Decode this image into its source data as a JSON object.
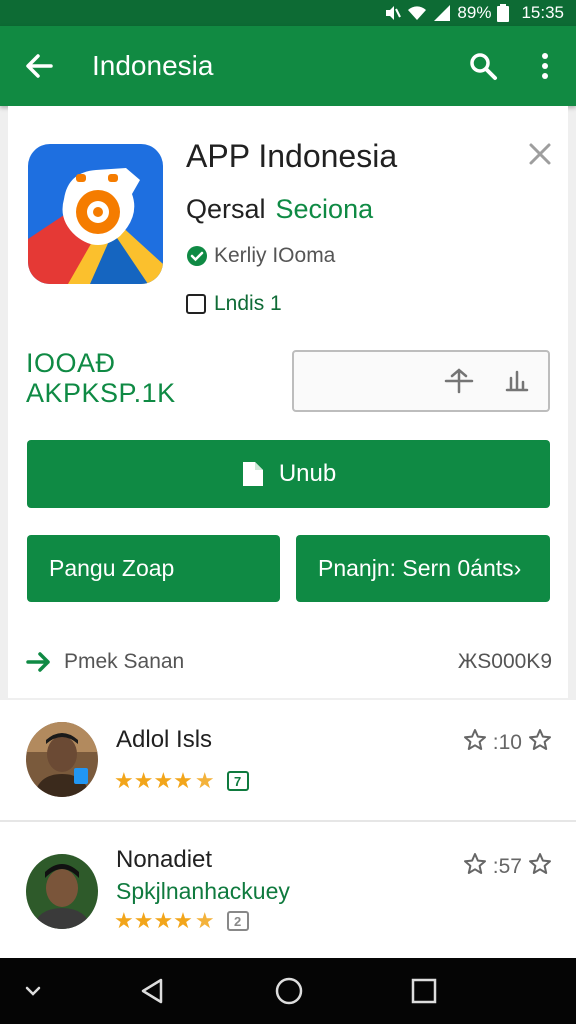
{
  "status_bar": {
    "battery": "89%",
    "time": "15:35"
  },
  "app_bar": {
    "title": "Indonesia"
  },
  "app": {
    "name": "APP Indonesia",
    "developer_part1": "Qersal",
    "developer_part2": "Seciona",
    "verified_label": "Kerliy IOoma",
    "content_rating_label": "Lndis 1",
    "meta_line1": "IOOAÐ",
    "meta_line2": "AKPKSP.1K"
  },
  "buttons": {
    "install": "Unub",
    "left": "Pangu Zoap",
    "right": "Pnanjn: Sern 0ánts›"
  },
  "section": {
    "label": "Pmek Sanan",
    "right_text": "ЖS000K9"
  },
  "reviews": [
    {
      "name": "Adlol Isls",
      "subtitle": "",
      "rating": 4.5,
      "badge": "7",
      "meta": ":10"
    },
    {
      "name": "Nonadiet",
      "subtitle": "Spkjlnanhackuey",
      "rating": 4.5,
      "badge": "2",
      "meta": ":57"
    }
  ],
  "colors": {
    "primary": "#118a42",
    "primary_dark": "#0d6b34",
    "star": "#f2a51a"
  }
}
